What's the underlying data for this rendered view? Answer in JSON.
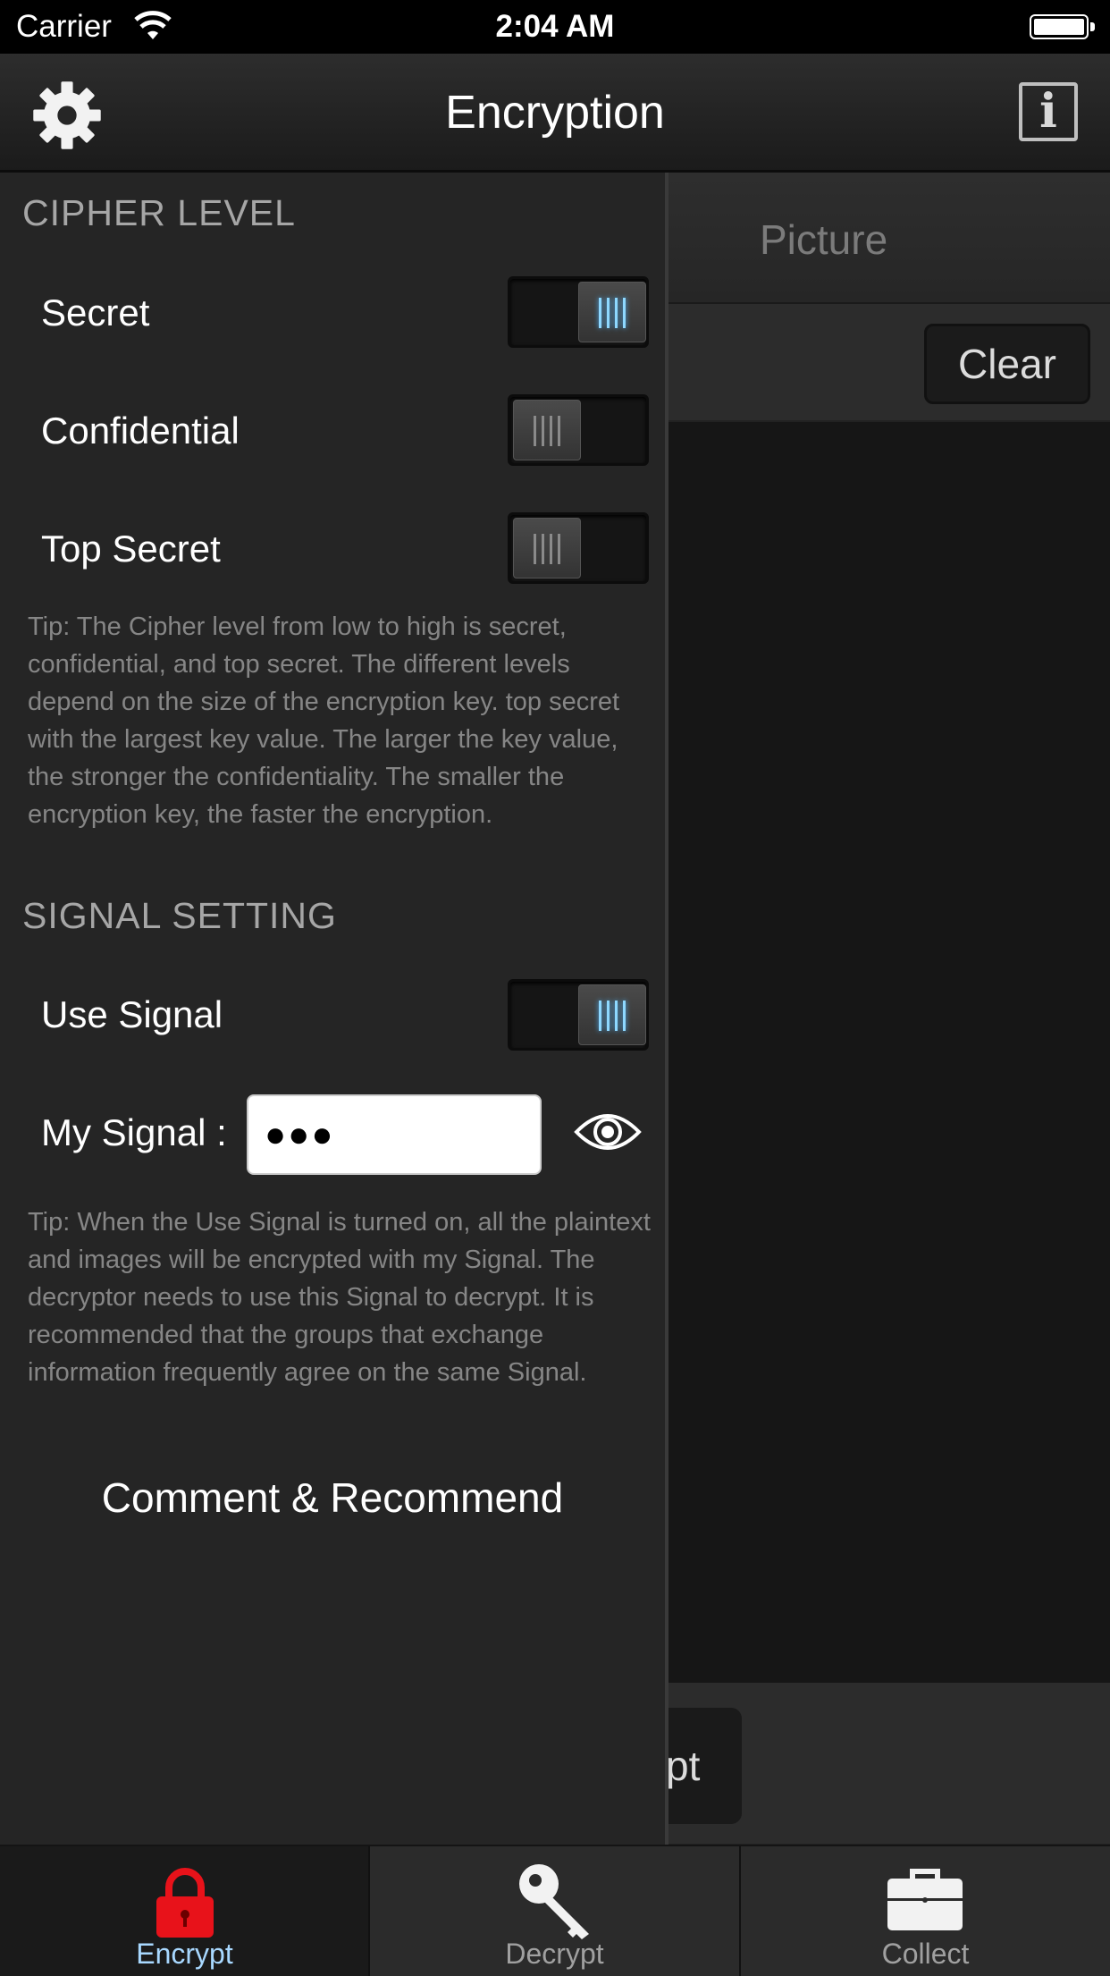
{
  "status_bar": {
    "carrier": "Carrier",
    "time": "2:04 AM"
  },
  "navbar": {
    "title": "Encryption"
  },
  "main": {
    "tab_label": "Picture",
    "clear_label": "Clear",
    "encrypt_partial": "pt"
  },
  "drawer": {
    "cipher_header": "CIPHER LEVEL",
    "cipher_levels": [
      {
        "label": "Secret",
        "on": true
      },
      {
        "label": "Confidential",
        "on": false
      },
      {
        "label": "Top Secret",
        "on": false
      }
    ],
    "cipher_tip": "Tip: The Cipher level from low to high is secret, confidential, and top secret. The different levels depend on the size of the encryption key. top secret with the largest key value. The larger the key value, the stronger the confidentiality.  The smaller the encryption key, the faster the encryption.",
    "signal_header": "SIGNAL SETTING",
    "use_signal_label": "Use Signal",
    "use_signal_on": true,
    "my_signal_label": "My Signal :",
    "my_signal_value": "●●●",
    "signal_tip": "Tip: When the Use Signal is turned on, all the plaintext and images will be encrypted with my Signal. The decryptor needs to use this Signal to decrypt. It is recommended that the groups that exchange information frequently agree on the same Signal.",
    "comment_label": "Comment & Recommend"
  },
  "tabbar": {
    "tabs": [
      {
        "label": "Encrypt",
        "icon": "lock-icon",
        "selected": true
      },
      {
        "label": "Decrypt",
        "icon": "key-icon",
        "selected": false
      },
      {
        "label": "Collect",
        "icon": "briefcase-icon",
        "selected": false
      }
    ]
  },
  "colors": {
    "accent": "#a8d8ff",
    "lock": "#e8121a",
    "switch_on": "#8ed8ff"
  }
}
